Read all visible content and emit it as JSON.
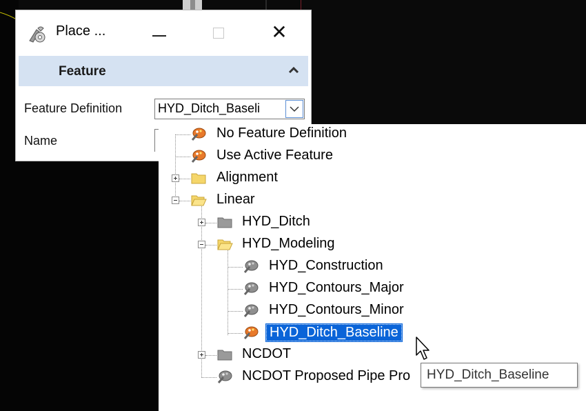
{
  "dialog": {
    "title": "Place ...",
    "app_icon": "feature-tool-icon",
    "controls": {
      "minimize": "minimize-icon",
      "maximize": "maximize-icon",
      "close": "close-icon"
    },
    "section": {
      "title": "Feature",
      "collapse_icon": "chevron-up-icon"
    },
    "fields": {
      "feature_definition_label": "Feature Definition",
      "feature_definition_value": "HYD_Ditch_Baseli",
      "name_label": "Name",
      "name_value": ""
    }
  },
  "tree": {
    "items": [
      {
        "label": "No Feature Definition",
        "icon": "feature-definition-icon"
      },
      {
        "label": "Use Active Feature",
        "icon": "feature-definition-icon"
      },
      {
        "label": "Alignment",
        "icon": "folder-icon",
        "expander": "collapsed"
      },
      {
        "label": "Linear",
        "icon": "folder-open-icon",
        "expander": "expanded"
      },
      {
        "label": "HYD_Ditch",
        "icon": "folder-gray-icon",
        "expander": "collapsed"
      },
      {
        "label": "HYD_Modeling",
        "icon": "folder-open-icon",
        "expander": "expanded"
      },
      {
        "label": "HYD_Construction",
        "icon": "feature-definition-gray-icon"
      },
      {
        "label": "HYD_Contours_Major",
        "icon": "feature-definition-gray-icon"
      },
      {
        "label": "HYD_Contours_Minor",
        "icon": "feature-definition-gray-icon"
      },
      {
        "label": "HYD_Ditch_Baseline",
        "icon": "feature-definition-icon",
        "selected": true
      },
      {
        "label": "NCDOT",
        "icon": "folder-gray-icon",
        "expander": "collapsed"
      },
      {
        "label": "NCDOT Proposed Pipe Pro",
        "icon": "feature-definition-gray-icon"
      }
    ]
  },
  "tooltip": {
    "text": "HYD_Ditch_Baseline"
  },
  "colors": {
    "selection": "#0a64d8",
    "section_header": "#d5e2f2",
    "background_dark": "#0a0a0a",
    "folder_yellow": "#f5d66a",
    "folder_gray": "#9a9a9a",
    "palette_orange": "#e8792a"
  }
}
